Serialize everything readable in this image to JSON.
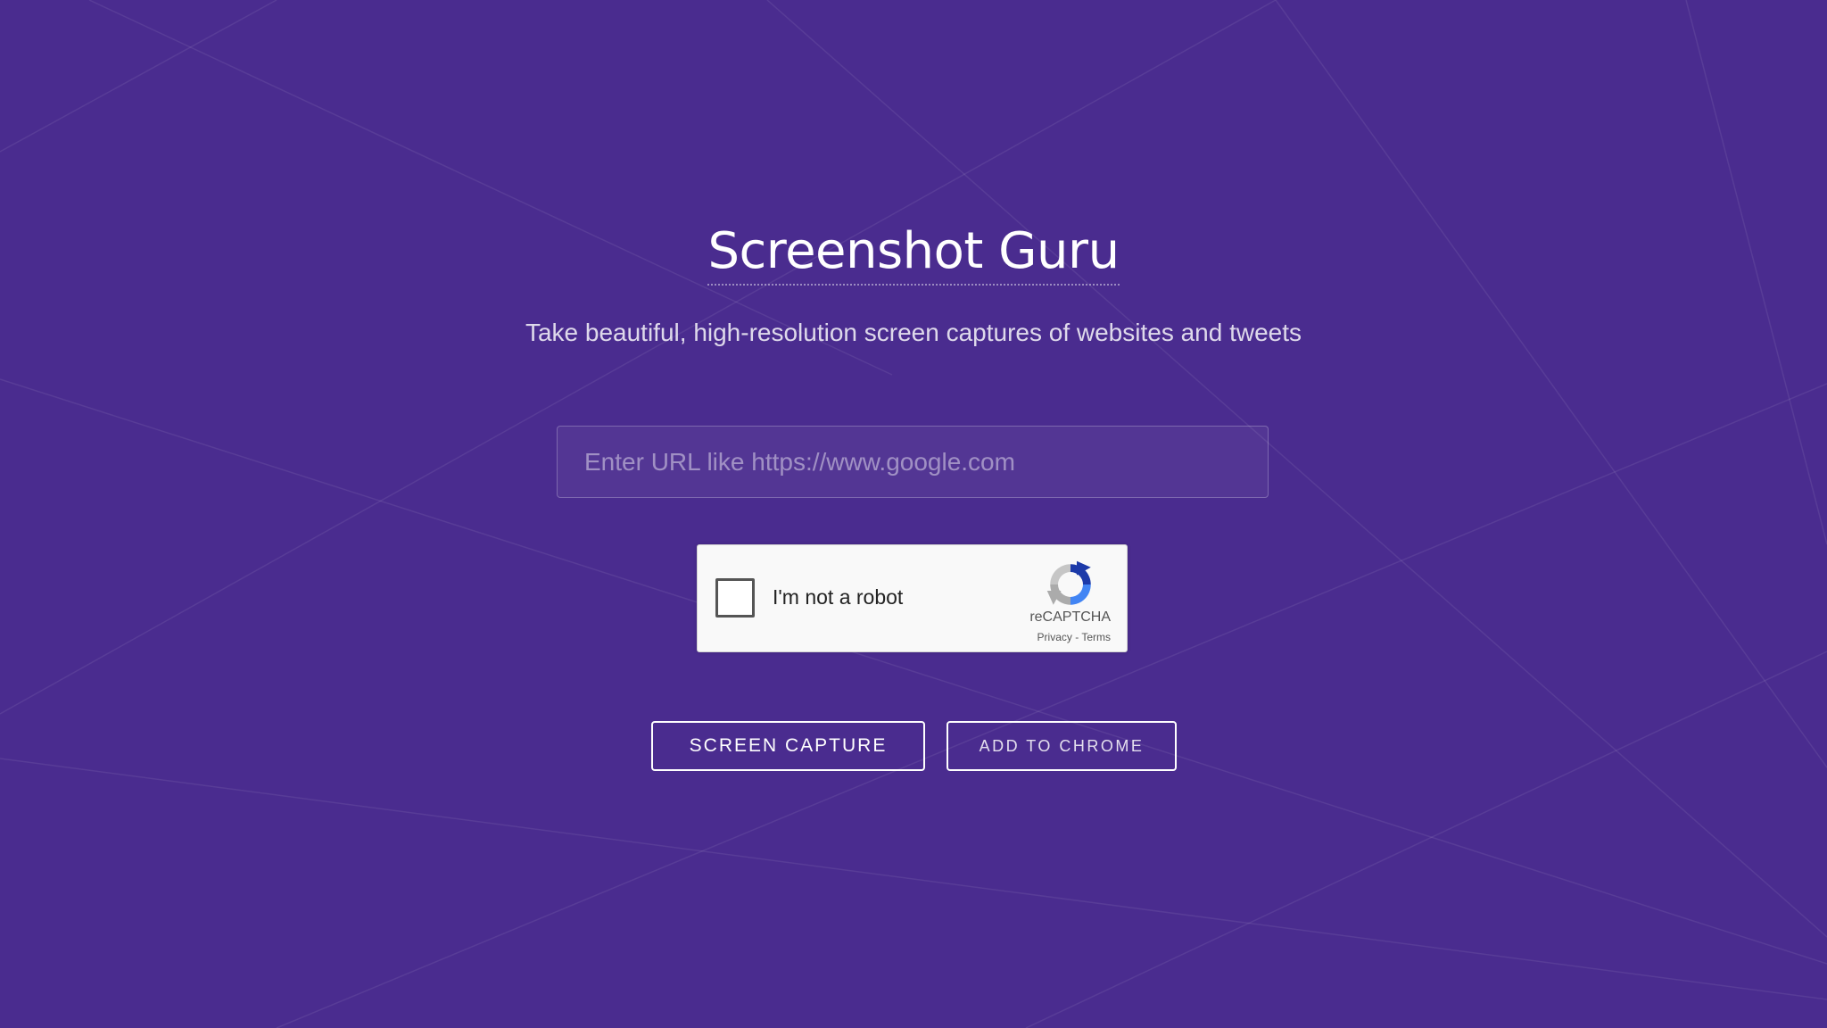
{
  "page": {
    "title": "Screenshot Guru",
    "subtitle": "Take beautiful, high-resolution screen captures of websites and tweets",
    "background_color": "#4a2c8f"
  },
  "url_input": {
    "value": "",
    "placeholder": "Enter URL like https://www.google.com"
  },
  "captcha": {
    "label": "I'm not a robot",
    "brand": "reCAPTCHA",
    "privacy_label": "Privacy",
    "separator": " - ",
    "terms_label": "Terms",
    "checked": false,
    "logo_icon": "recaptcha-icon"
  },
  "buttons": {
    "screen_capture_label": "SCREEN CAPTURE",
    "add_to_chrome_label": "ADD TO CHROME"
  }
}
